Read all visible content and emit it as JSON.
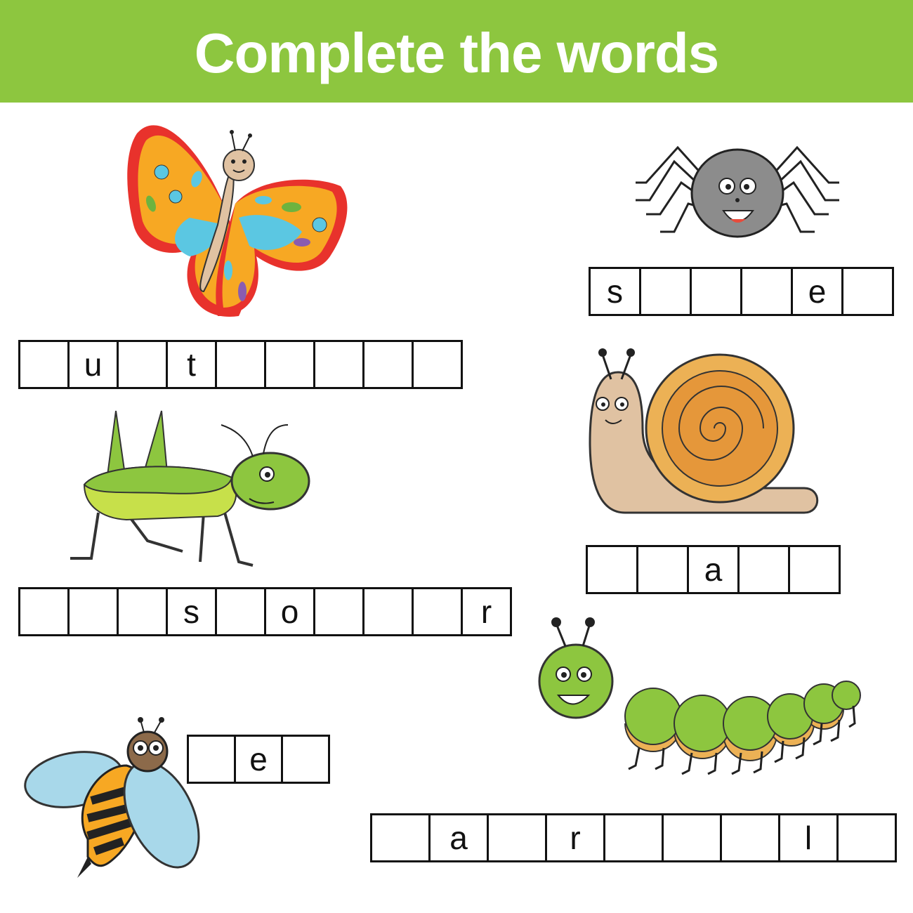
{
  "header": {
    "title": "Complete the words",
    "background_color": "#8dc63f"
  },
  "words": {
    "butterfly": {
      "illustration": "butterfly-illustration",
      "cells": [
        "",
        "u",
        "",
        "t",
        "",
        "",
        "",
        "",
        ""
      ]
    },
    "spider": {
      "illustration": "spider-illustration",
      "cells": [
        "s",
        "",
        "",
        "",
        "e",
        ""
      ]
    },
    "snail": {
      "illustration": "snail-illustration",
      "cells": [
        "",
        "",
        "a",
        "",
        ""
      ]
    },
    "grasshopper": {
      "illustration": "grasshopper-illustration",
      "cells": [
        "",
        "",
        "",
        "s",
        "",
        "o",
        "",
        "",
        "",
        "r"
      ]
    },
    "bee": {
      "illustration": "bee-illustration",
      "cells": [
        "",
        "e",
        ""
      ]
    },
    "caterpillar": {
      "illustration": "caterpillar-illustration",
      "cells": [
        "",
        "a",
        "",
        "r",
        "",
        "",
        "",
        "l",
        ""
      ]
    }
  }
}
